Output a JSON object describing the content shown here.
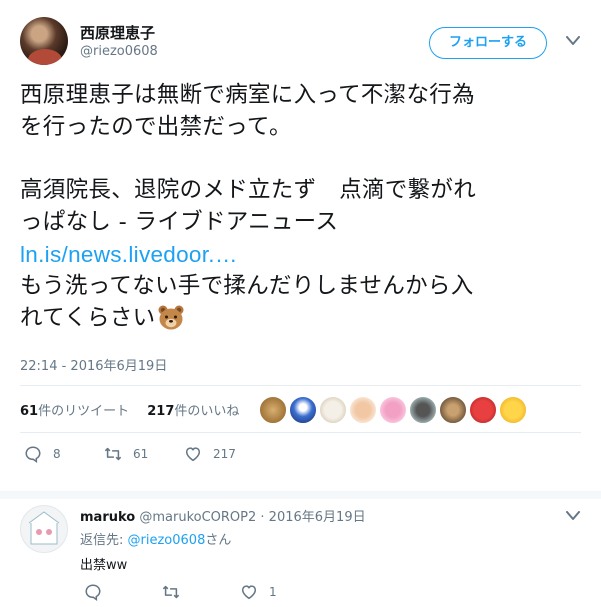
{
  "tweet": {
    "display_name": "西原理恵子",
    "handle": "@riezo0608",
    "follow_label": "フォローする",
    "lines": [
      "西原理恵子は無断で病室に入って不潔な行為",
      "を行ったので出禁だって。",
      "",
      "高須院長、退院のメド立たず　点滴で繋がれ",
      "っぱなし - ライブドアニュース"
    ],
    "link": "ln.is/news.livedoor.…",
    "line_after_link": "もう洗ってない手で揉んだりしませんから入",
    "last_line": "れてくらさい",
    "emoji_icon": "bear-face-icon",
    "timestamp": "22:14 - 2016年6月19日",
    "retweets_count": "61",
    "retweets_label": "件のリツイート",
    "likes_count": "217",
    "likes_label": "件のいいね",
    "actions": {
      "reply_count": "8",
      "retweet_count": "61",
      "like_count": "217"
    }
  },
  "reply": {
    "display_name": "maruko",
    "handle": "@marukoCOROP2",
    "date": "· 2016年6月19日",
    "reply_to_prefix": "返信先:",
    "reply_to_mention": "@riezo0608",
    "reply_to_suffix": "さん",
    "text": "出禁ww",
    "actions": {
      "like_count": "1"
    }
  },
  "colors": {
    "accent": "#1da1f2",
    "muted": "#657786",
    "text": "#14171a",
    "divider": "#e6ecf0"
  }
}
